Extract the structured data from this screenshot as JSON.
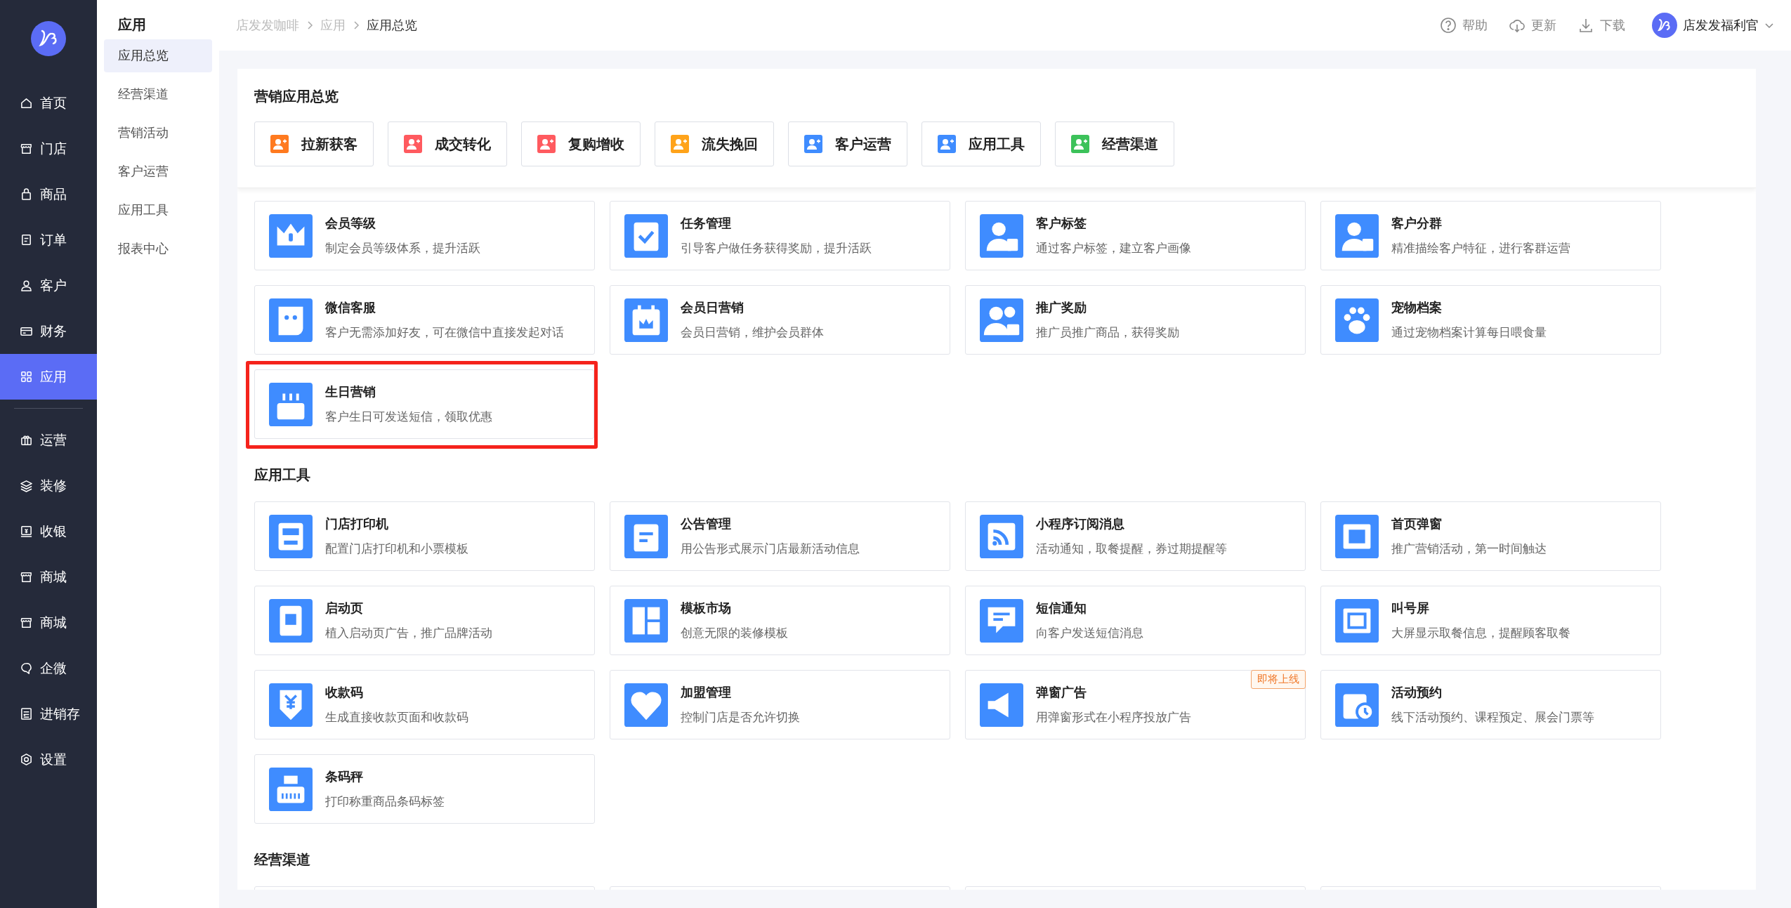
{
  "sidebar": {
    "items": [
      {
        "label": "首页",
        "selected": false
      },
      {
        "label": "门店",
        "selected": false
      },
      {
        "label": "商品",
        "selected": false
      },
      {
        "label": "订单",
        "selected": false
      },
      {
        "label": "客户",
        "selected": false
      },
      {
        "label": "财务",
        "selected": false
      },
      {
        "label": "应用",
        "selected": true
      },
      {
        "label": "运营",
        "selected": false
      },
      {
        "label": "装修",
        "selected": false
      },
      {
        "label": "收银",
        "selected": false
      },
      {
        "label": "商城",
        "selected": false
      },
      {
        "label": "商城",
        "selected": false
      },
      {
        "label": "企微",
        "selected": false
      },
      {
        "label": "进销存",
        "selected": false
      },
      {
        "label": "设置",
        "selected": false
      }
    ]
  },
  "subnav": {
    "title": "应用",
    "items": [
      {
        "label": "应用总览",
        "selected": true
      },
      {
        "label": "经营渠道",
        "selected": false
      },
      {
        "label": "营销活动",
        "selected": false
      },
      {
        "label": "客户运营",
        "selected": false
      },
      {
        "label": "应用工具",
        "selected": false
      },
      {
        "label": "报表中心",
        "selected": false
      }
    ]
  },
  "breadcrumb": [
    "店发发咖啡",
    "应用",
    "应用总览"
  ],
  "header_actions": [
    "帮助",
    "更新",
    "下载"
  ],
  "user": {
    "name": "店发发福利官"
  },
  "overview": {
    "title": "营销应用总览",
    "categories": [
      {
        "label": "拉新获客",
        "color": "#ff7a1f"
      },
      {
        "label": "成交转化",
        "color": "#ff5a5f"
      },
      {
        "label": "复购增收",
        "color": "#ff5a5f"
      },
      {
        "label": "流失挽回",
        "color": "#ffa31a"
      },
      {
        "label": "客户运营",
        "color": "#3f8cff"
      },
      {
        "label": "应用工具",
        "color": "#3f8cff"
      },
      {
        "label": "经营渠道",
        "color": "#3cc25a"
      }
    ]
  },
  "sections": [
    {
      "cards": [
        {
          "title": "会员等级",
          "desc": "制定会员等级体系，提升活跃",
          "highlighted": false
        },
        {
          "title": "任务管理",
          "desc": "引导客户做任务获得奖励，提升活跃",
          "highlighted": false
        },
        {
          "title": "客户标签",
          "desc": "通过客户标签，建立客户画像",
          "highlighted": false
        },
        {
          "title": "客户分群",
          "desc": "精准描绘客户特征，进行客群运营",
          "highlighted": false
        },
        {
          "title": "微信客服",
          "desc": "客户无需添加好友，可在微信中直接发起对话",
          "highlighted": false
        },
        {
          "title": "会员日营销",
          "desc": "会员日营销，维护会员群体",
          "highlighted": false
        },
        {
          "title": "推广奖励",
          "desc": "推广员推广商品，获得奖励",
          "highlighted": false
        },
        {
          "title": "宠物档案",
          "desc": "通过宠物档案计算每日喂食量",
          "highlighted": false
        },
        {
          "title": "生日营销",
          "desc": "客户生日可发送短信，领取优惠",
          "highlighted": true
        }
      ]
    },
    {
      "title": "应用工具",
      "cards": [
        {
          "title": "门店打印机",
          "desc": "配置门店打印机和小票模板",
          "highlighted": false
        },
        {
          "title": "公告管理",
          "desc": "用公告形式展示门店最新活动信息",
          "highlighted": false
        },
        {
          "title": "小程序订阅消息",
          "desc": "活动通知，取餐提醒，券过期提醒等",
          "highlighted": false
        },
        {
          "title": "首页弹窗",
          "desc": "推广营销活动，第一时间触达",
          "highlighted": false
        },
        {
          "title": "启动页",
          "desc": "植入启动页广告，推广品牌活动",
          "highlighted": false
        },
        {
          "title": "模板市场",
          "desc": "创意无限的装修模板",
          "highlighted": false
        },
        {
          "title": "短信通知",
          "desc": "向客户发送短信消息",
          "highlighted": false
        },
        {
          "title": "叫号屏",
          "desc": "大屏显示取餐信息，提醒顾客取餐",
          "highlighted": false
        },
        {
          "title": "收款码",
          "desc": "生成直接收款页面和收款码",
          "highlighted": false
        },
        {
          "title": "加盟管理",
          "desc": "控制门店是否允许切换",
          "highlighted": false
        },
        {
          "title": "弹窗广告",
          "desc": "用弹窗形式在小程序投放广告",
          "highlighted": false,
          "badge": "即将上线"
        },
        {
          "title": "活动预约",
          "desc": "线下活动预约、课程预定、展会门票等",
          "highlighted": false
        },
        {
          "title": "条码秤",
          "desc": "打印称重商品条码标签",
          "highlighted": false
        }
      ]
    },
    {
      "title": "经营渠道"
    }
  ]
}
